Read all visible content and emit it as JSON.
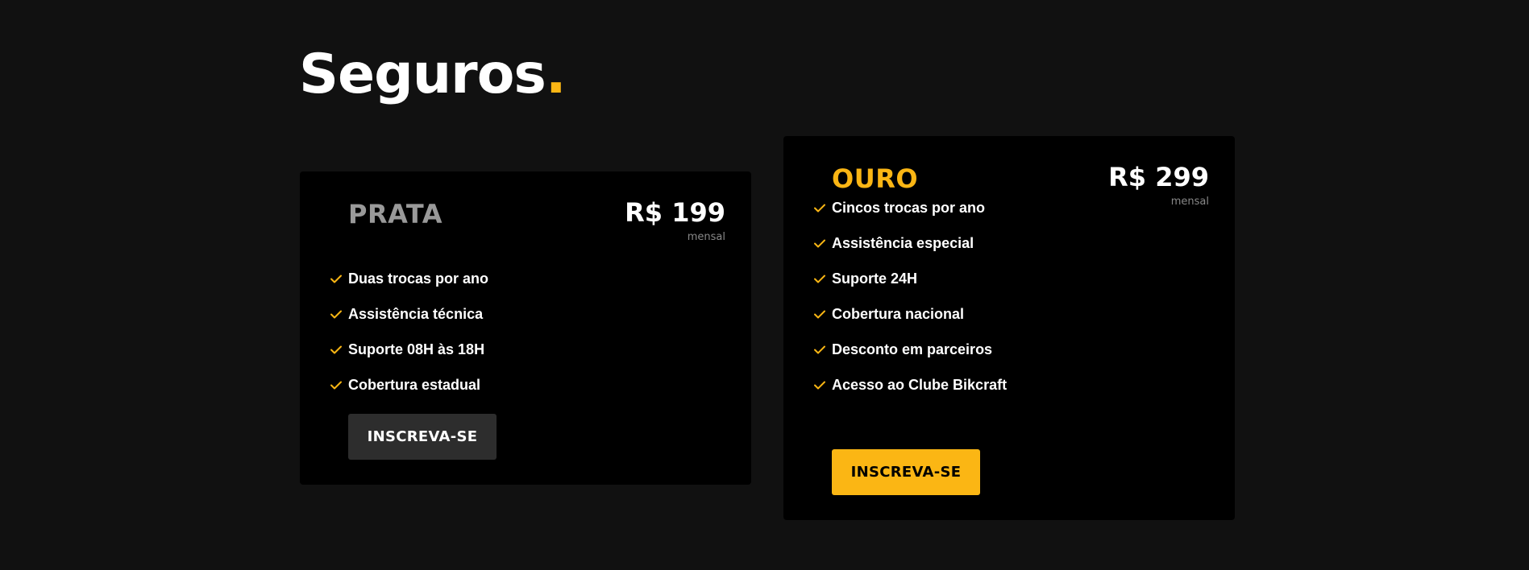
{
  "title": {
    "text": "Seguros",
    "dot": "."
  },
  "plans": [
    {
      "name": "PRATA",
      "price": "R$ 199",
      "period": "mensal",
      "features": [
        "Duas trocas por ano",
        "Assistência técnica",
        "Suporte 08H às 18H",
        "Cobertura estadual"
      ],
      "button_label": "INSCREVA-SE"
    },
    {
      "name": "OURO",
      "price": "R$ 299",
      "period": "mensal",
      "features": [
        "Cincos trocas por ano",
        "Assistência especial",
        "Suporte 24H",
        "Cobertura nacional",
        "Desconto em parceiros",
        "Acesso ao Clube Bikcraft"
      ],
      "button_label": "INSCREVA-SE"
    }
  ],
  "icons": {
    "feature": "check-icon"
  },
  "colors": {
    "background": "#111111",
    "card": "#000000",
    "accent": "#fbb614",
    "prata_name": "#999999",
    "prata_button": "#2d2d2d"
  }
}
